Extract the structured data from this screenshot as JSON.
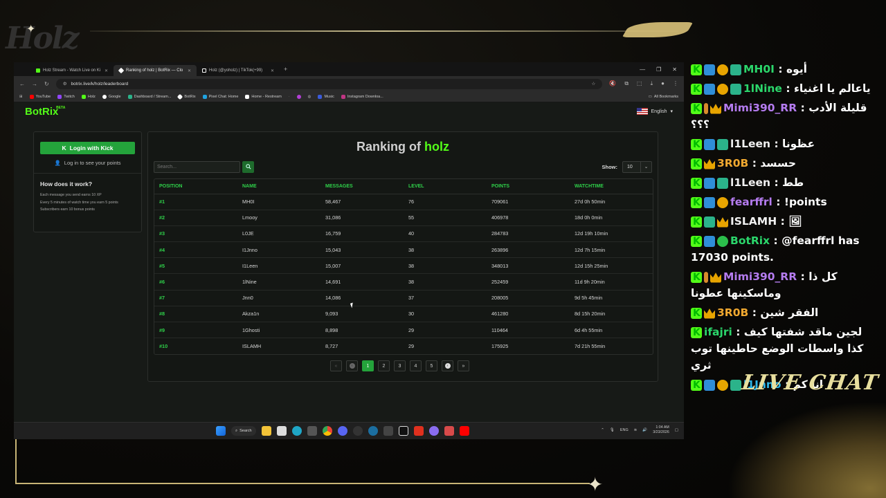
{
  "overlay": {
    "logo": "Holz",
    "live_chat_label": "LIVE CHAT"
  },
  "browser": {
    "tabs": [
      {
        "label": "Holz Stream - Watch Live on Ki",
        "favicon_color": "#53fc18",
        "active": false
      },
      {
        "label": "Ranking of holz | BotRix — Clo",
        "favicon_color": "#ffffff",
        "active": true
      },
      {
        "label": "Holz (@yoholz) | TikTok(+99)",
        "favicon_color": "#ffffff",
        "active": false
      }
    ],
    "new_tab": "+",
    "url": "botrix.live/k/holz/leaderboard",
    "bookmarks": [
      {
        "label": "YouTube",
        "color": "#ff0000"
      },
      {
        "label": "Twitch",
        "color": "#9146ff"
      },
      {
        "label": "Holz",
        "color": "#53fc18"
      },
      {
        "label": "Google",
        "color": "#ffffff"
      },
      {
        "label": "Dashboard / Stream...",
        "color": "#2bb38a"
      },
      {
        "label": "BotRix",
        "color": "#ffffff"
      },
      {
        "label": "Pixel Chat: Home",
        "color": "#1fa3e0"
      },
      {
        "label": "Home - Restream",
        "color": "#ffffff"
      },
      {
        "label": "Music",
        "color": "#3b5bdb"
      },
      {
        "label": "Instagram Downloa...",
        "color": "#c13584"
      }
    ],
    "all_bookmarks": "All Bookmarks"
  },
  "site": {
    "brand": "BotRix",
    "brand_tag": "BETA",
    "language": "English"
  },
  "sidebar": {
    "login_button": "Login with Kick",
    "login_hint": "Log in to see your points",
    "how_title": "How does it work?",
    "how_lines": [
      "Each message you send earns 10 XP",
      "Every 5 minutes of watch time you earn 5 points",
      "Subscribers earn 10 bonus points"
    ]
  },
  "ranking": {
    "title_prefix": "Ranking of",
    "channel": "holz",
    "search_placeholder": "Search...",
    "show_label": "Show:",
    "show_value": "10",
    "columns": [
      "POSITION",
      "NAME",
      "MESSAGES",
      "LEVEL",
      "POINTS",
      "WATCHTIME"
    ],
    "rows": [
      [
        "#1",
        "MH0I",
        "58,467",
        "76",
        "709061",
        "27d 0h 50min"
      ],
      [
        "#2",
        "Lmooy",
        "31,086",
        "55",
        "406978",
        "18d 0h 0min"
      ],
      [
        "#3",
        "L0JE",
        "16,759",
        "40",
        "284783",
        "12d 19h 10min"
      ],
      [
        "#4",
        "I1Jnno",
        "15,043",
        "38",
        "263896",
        "12d 7h 15min"
      ],
      [
        "#5",
        "I1Leen",
        "15,007",
        "38",
        "348013",
        "12d 15h 25min"
      ],
      [
        "#6",
        "1lNine",
        "14,691",
        "38",
        "252459",
        "11d 9h 20min"
      ],
      [
        "#7",
        "Jnn0",
        "14,086",
        "37",
        "208005",
        "9d 5h 45min"
      ],
      [
        "#8",
        "Akza1n",
        "9,093",
        "30",
        "461280",
        "8d 15h 20min"
      ],
      [
        "#9",
        "1Ghosti",
        "8,898",
        "29",
        "110464",
        "6d 4h 55min"
      ],
      [
        "#10",
        "ISLAMH",
        "8,727",
        "29",
        "175925",
        "7d 21h 55min"
      ]
    ],
    "pager": {
      "first": "«",
      "pages": [
        "1",
        "2",
        "3",
        "4",
        "5"
      ],
      "active_page": "1",
      "last": "»"
    }
  },
  "taskbar": {
    "search_label": "Search",
    "lang": "ENG",
    "time": "1:04 AM",
    "date": "3/23/2026"
  },
  "chat": {
    "messages": [
      {
        "badges": [
          "k",
          "vip",
          "sub",
          "gift"
        ],
        "user": "MH0I",
        "user_color": "#2bd66b",
        "text": "أيوه"
      },
      {
        "badges": [
          "k",
          "vip",
          "sub",
          "gift"
        ],
        "user": "1lNine",
        "user_color": "#2bd66b",
        "text": "ياعالم يا اغنياء"
      },
      {
        "badges": [
          "k",
          "og",
          "crown"
        ],
        "user": "Mimi390_RR",
        "user_color": "#b57cf0",
        "text": "قليلة الأدب ؟؟؟"
      },
      {
        "badges": [
          "k",
          "vip",
          "gift"
        ],
        "user": "l1Leen",
        "user_color": "#f0f0f0",
        "text": "عظونا"
      },
      {
        "badges": [
          "k",
          "crown"
        ],
        "user": "3R0B",
        "user_color": "#f0a830",
        "text": "حسسد"
      },
      {
        "badges": [
          "k",
          "vip",
          "gift"
        ],
        "user": "l1Leen",
        "user_color": "#f0f0f0",
        "text": "طط"
      },
      {
        "badges": [
          "k",
          "vip",
          "sub"
        ],
        "user": "fearffrl",
        "user_color": "#b57cf0",
        "text": "!points"
      },
      {
        "badges": [
          "k",
          "gift",
          "crown"
        ],
        "user": "ISLAMH",
        "user_color": "#f0f0f0",
        "text": "🖼"
      },
      {
        "badges": [
          "k",
          "vip",
          "mod"
        ],
        "user": "BotRix",
        "user_color": "#2bd66b",
        "text": "@fearffrl has 17030 points."
      },
      {
        "badges": [
          "k",
          "og",
          "crown"
        ],
        "user": "Mimi390_RR",
        "user_color": "#b57cf0",
        "text": "كل ذا وماسكينها عطونا"
      },
      {
        "badges": [
          "k",
          "crown"
        ],
        "user": "3R0B",
        "user_color": "#f0a830",
        "text": "الفقر شين"
      },
      {
        "badges": [
          "k"
        ],
        "user": "ifajri",
        "user_color": "#2bd66b",
        "text": "لجين ماقد شفتها كيف كذا واسطات الوضع حاطينها توب ثري"
      },
      {
        "badges": [
          "k",
          "vip",
          "sub",
          "gift"
        ],
        "user": "l1Jnno",
        "user_color": "#2fb6e8",
        "text": "انا كم"
      }
    ]
  }
}
